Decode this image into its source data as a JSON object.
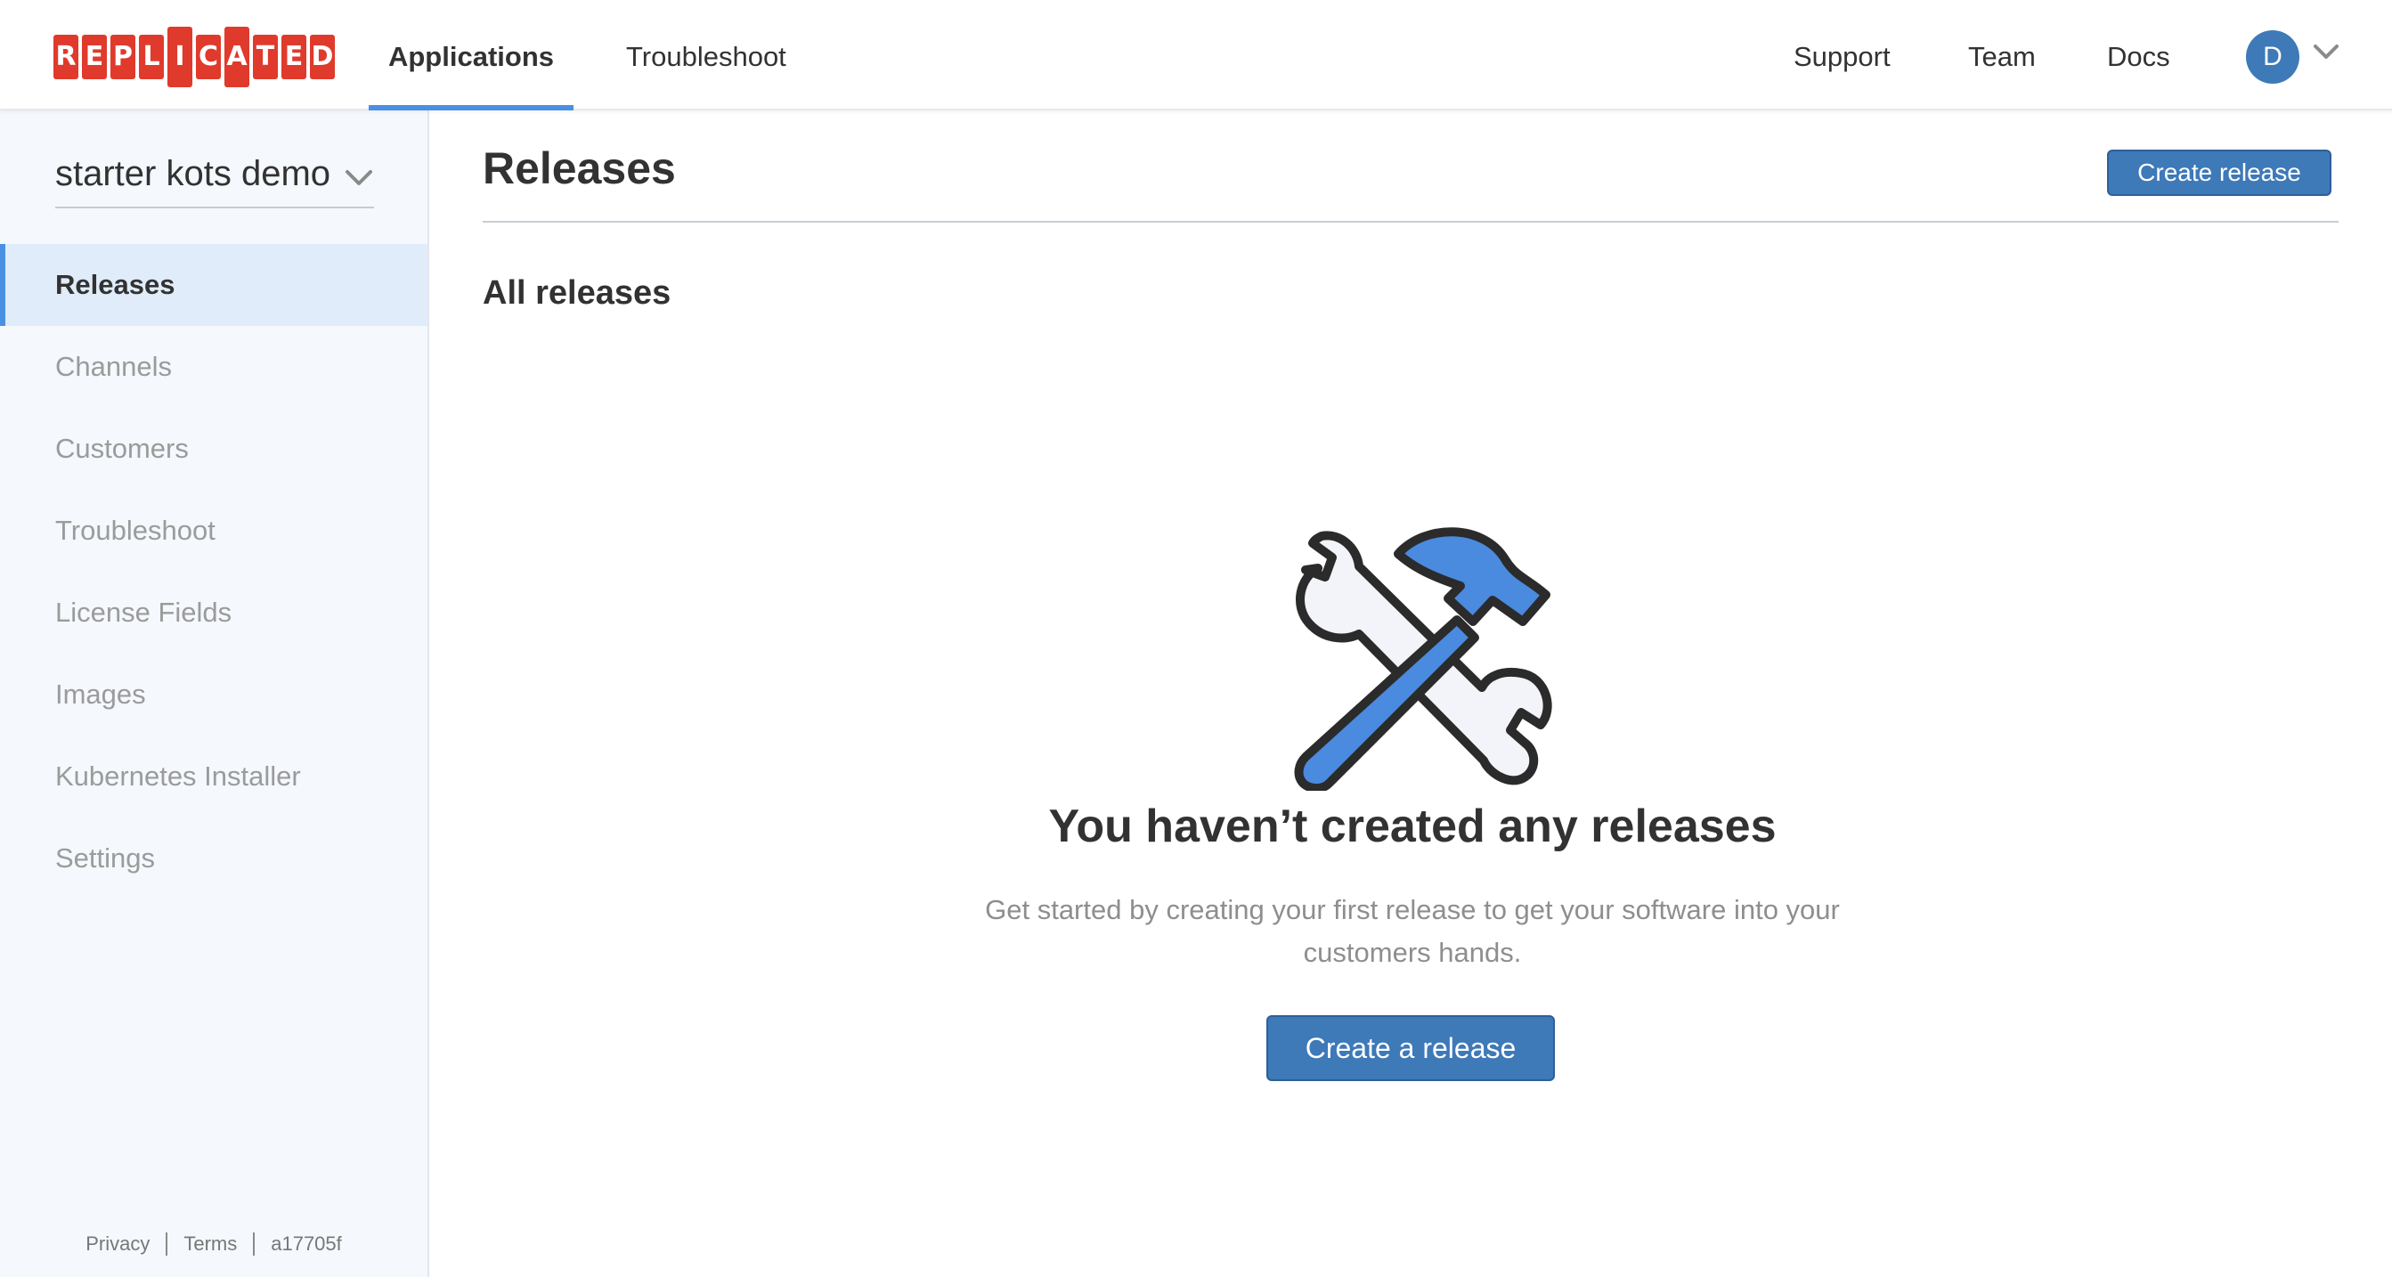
{
  "brand": {
    "logo_text": "REPLICATED",
    "logo_color": "#e03a2c"
  },
  "topnav": {
    "applications": "Applications",
    "troubleshoot": "Troubleshoot",
    "support": "Support",
    "team": "Team",
    "docs": "Docs",
    "avatar_initial": "D"
  },
  "sidebar": {
    "app_name": "starter kots demo",
    "items": [
      {
        "label": "Releases",
        "active": true
      },
      {
        "label": "Channels",
        "active": false
      },
      {
        "label": "Customers",
        "active": false
      },
      {
        "label": "Troubleshoot",
        "active": false
      },
      {
        "label": "License Fields",
        "active": false
      },
      {
        "label": "Images",
        "active": false
      },
      {
        "label": "Kubernetes Installer",
        "active": false
      },
      {
        "label": "Settings",
        "active": false
      }
    ],
    "footer": {
      "privacy": "Privacy",
      "terms": "Terms",
      "version": "a17705f"
    }
  },
  "main": {
    "title": "Releases",
    "create_release_button": "Create release",
    "section_title": "All releases",
    "empty_state": {
      "icon": "wrench-hammer-icon",
      "title": "You haven’t created any releases",
      "description": "Get started by creating your first release to get your software into your customers hands.",
      "button": "Create a release"
    }
  },
  "colors": {
    "accent": "#4a90e2",
    "button": "#3e79b8",
    "sidebar_bg": "#f5f8fc",
    "active_item_bg": "#e1ecfb"
  }
}
